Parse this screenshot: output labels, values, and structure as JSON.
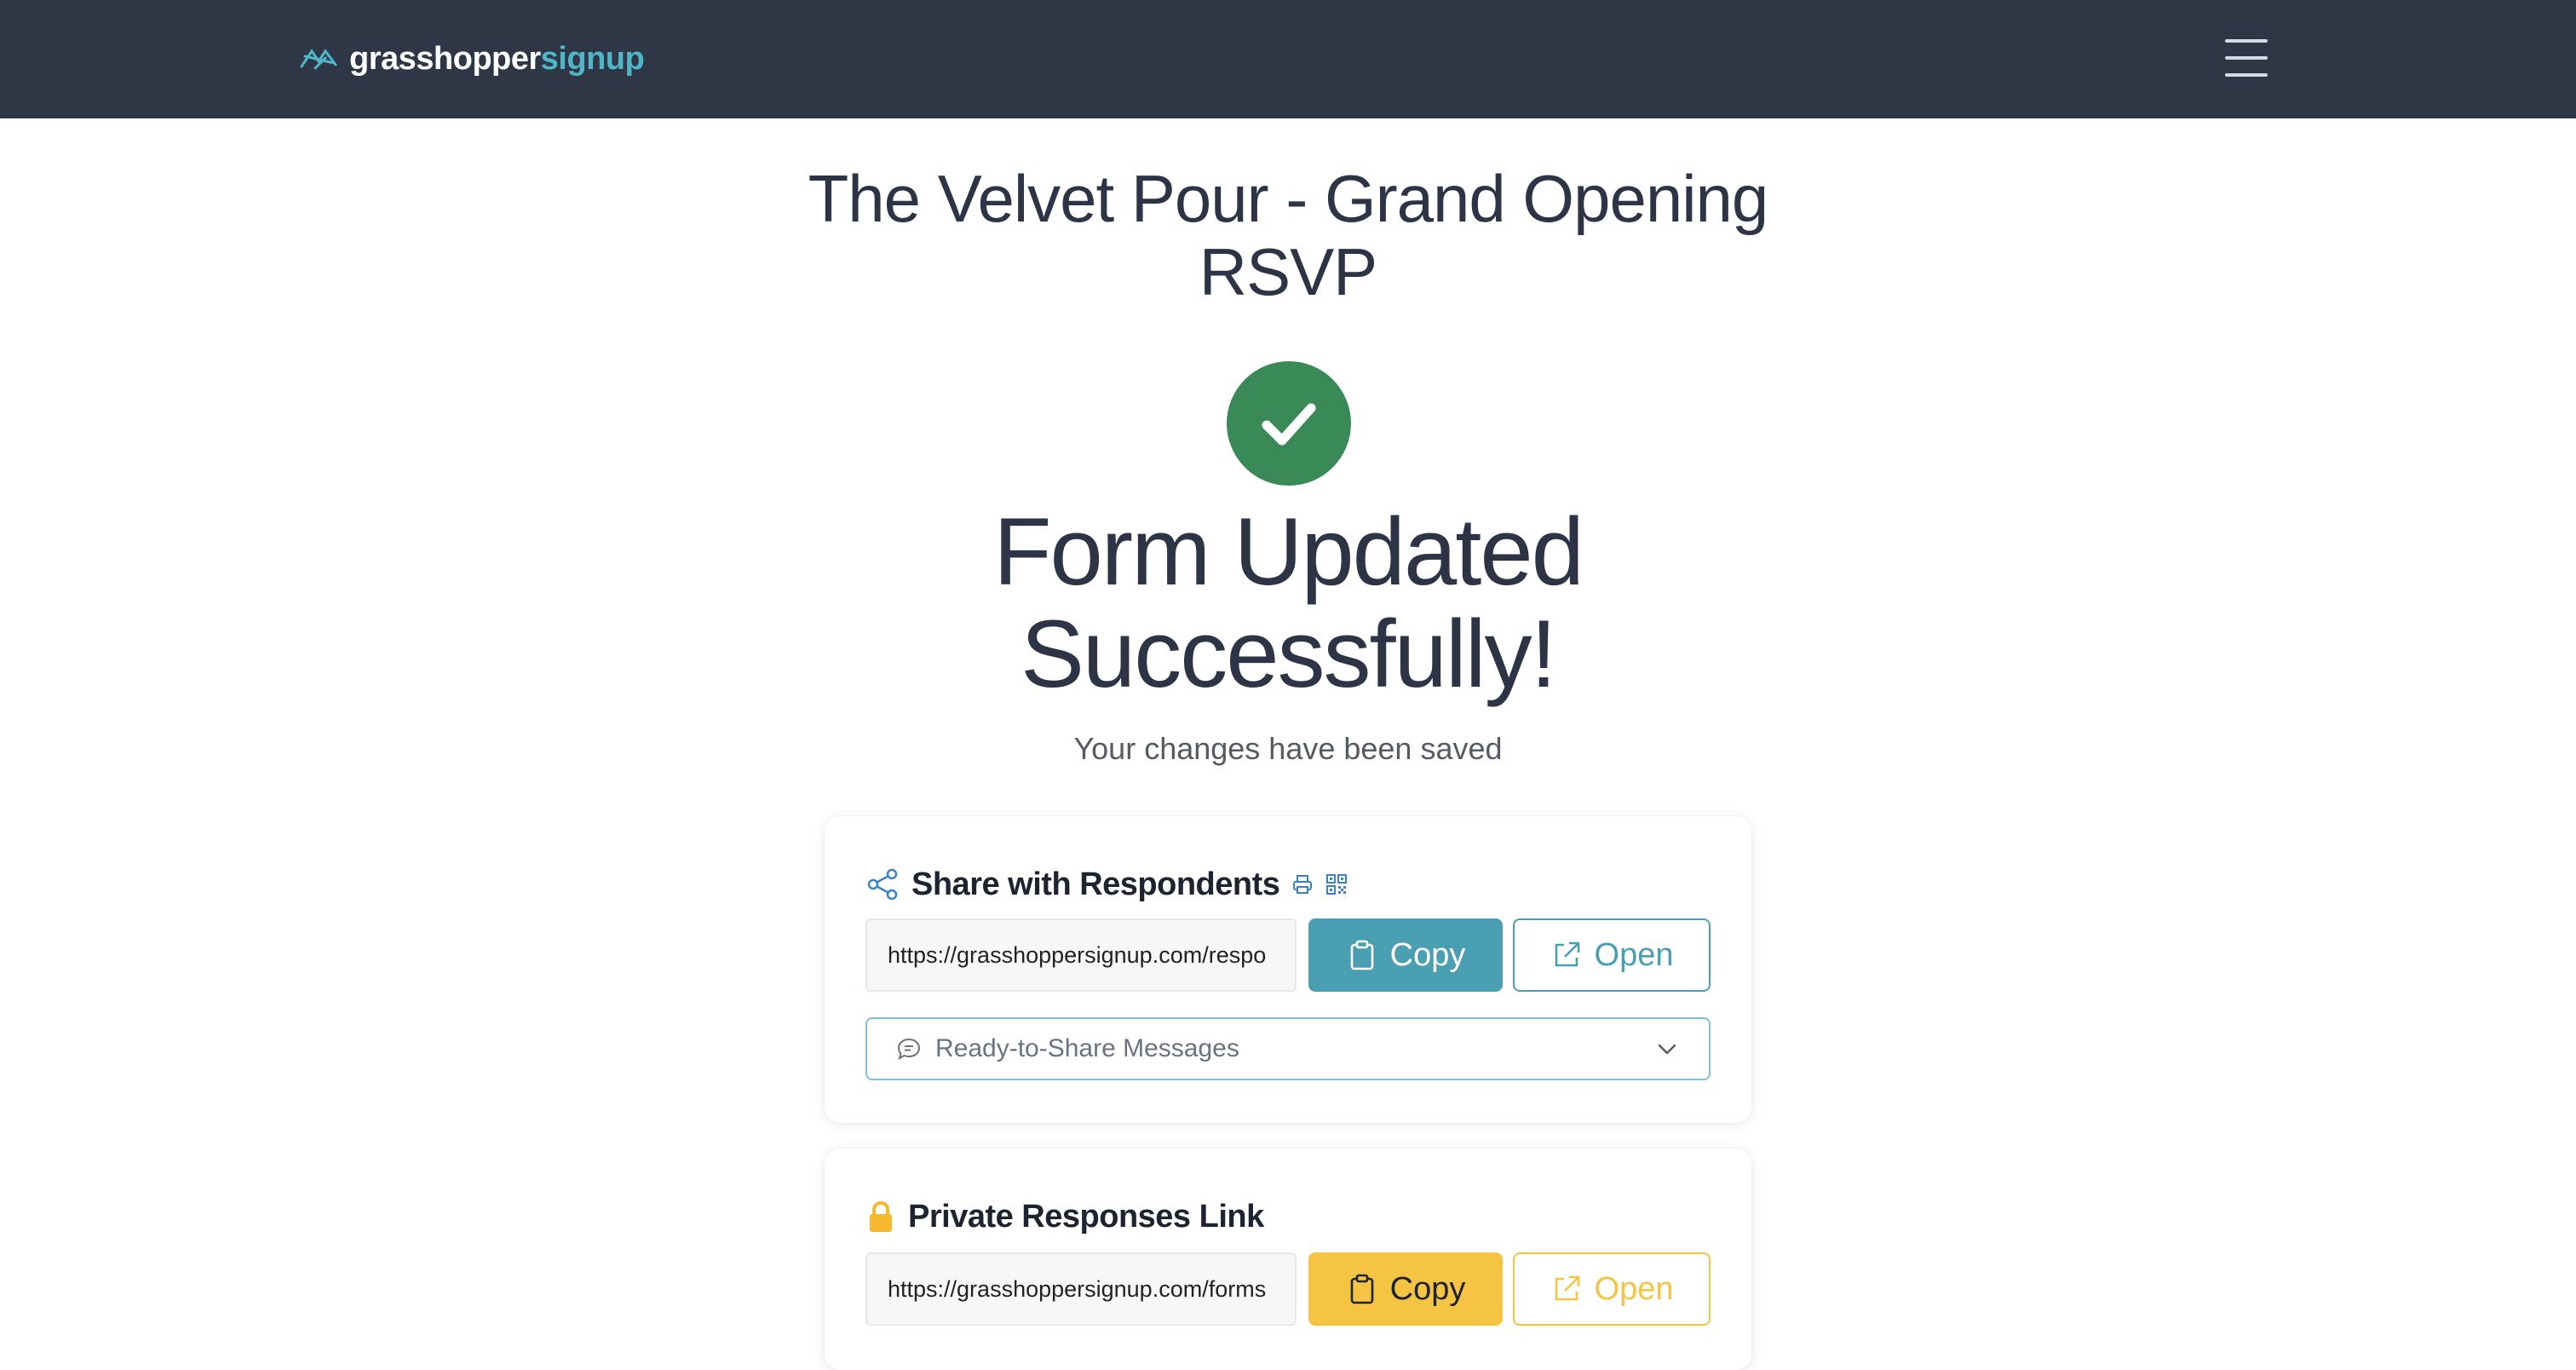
{
  "nav": {
    "logo_part1": "grasshopper",
    "logo_part2": "signup"
  },
  "page": {
    "event_title": "The Velvet Pour - Grand Opening RSVP",
    "success_title": "Form Updated Successfully!",
    "success_subtitle": "Your changes have been saved"
  },
  "share_card": {
    "title": "Share with Respondents",
    "url": "https://grasshoppersignup.com/respo",
    "copy_label": "Copy",
    "open_label": "Open",
    "messages_label": "Ready-to-Share Messages"
  },
  "private_card": {
    "title": "Private Responses Link",
    "url": "https://grasshoppersignup.com/forms",
    "copy_label": "Copy",
    "open_label": "Open"
  },
  "colors": {
    "navbar": "#2f3646",
    "brand_teal": "#4fb6c8",
    "success_green": "#3a8a57",
    "button_teal": "#4a9fb2",
    "button_yellow": "#f5c442"
  },
  "icons": {
    "logo": "grasshopper-logo-icon",
    "menu": "hamburger-menu-icon",
    "success": "checkmark-icon",
    "share": "share-icon",
    "print": "print-icon",
    "qr": "qr-code-icon",
    "copy": "clipboard-icon",
    "open": "external-link-icon",
    "messages": "chat-bubble-icon",
    "chevron": "chevron-down-icon",
    "lock": "lock-icon"
  }
}
